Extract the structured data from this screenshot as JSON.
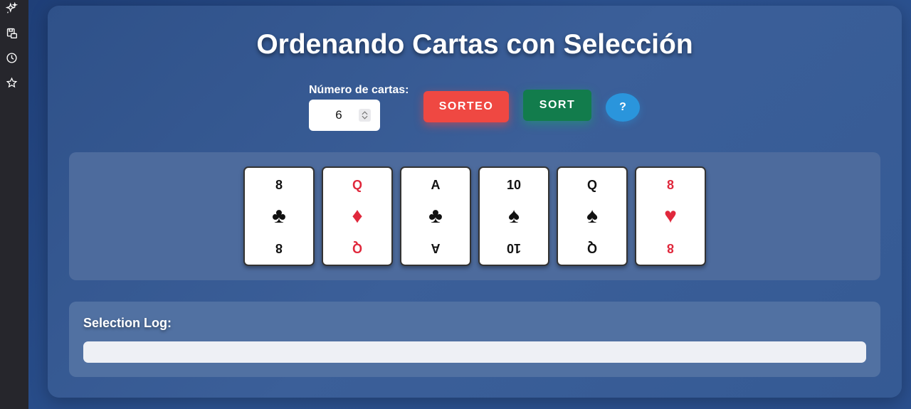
{
  "sidebar": {
    "icons": [
      "sparkle-icon",
      "save-icon",
      "history-icon",
      "star-icon"
    ]
  },
  "header": {
    "title": "Ordenando Cartas con Selección"
  },
  "controls": {
    "count_label": "Número de cartas:",
    "count_value": "6",
    "sorteo_label": "SORTEO",
    "sort_label": "SORT",
    "help_label": "?"
  },
  "cards": [
    {
      "rank": "8",
      "suit": "♣",
      "suit_name": "clubs",
      "color": "black"
    },
    {
      "rank": "Q",
      "suit": "♦",
      "suit_name": "diamonds",
      "color": "red"
    },
    {
      "rank": "A",
      "suit": "♣",
      "suit_name": "clubs",
      "color": "black"
    },
    {
      "rank": "10",
      "suit": "♠",
      "suit_name": "spades",
      "color": "black"
    },
    {
      "rank": "Q",
      "suit": "♠",
      "suit_name": "spades",
      "color": "black"
    },
    {
      "rank": "8",
      "suit": "♥",
      "suit_name": "hearts",
      "color": "red"
    }
  ],
  "log": {
    "title": "Selection Log:",
    "content": ""
  },
  "colors": {
    "sorteo": "#ef4842",
    "sort": "#127c4c",
    "help": "#2a95dc",
    "red_suit": "#e0283c"
  }
}
